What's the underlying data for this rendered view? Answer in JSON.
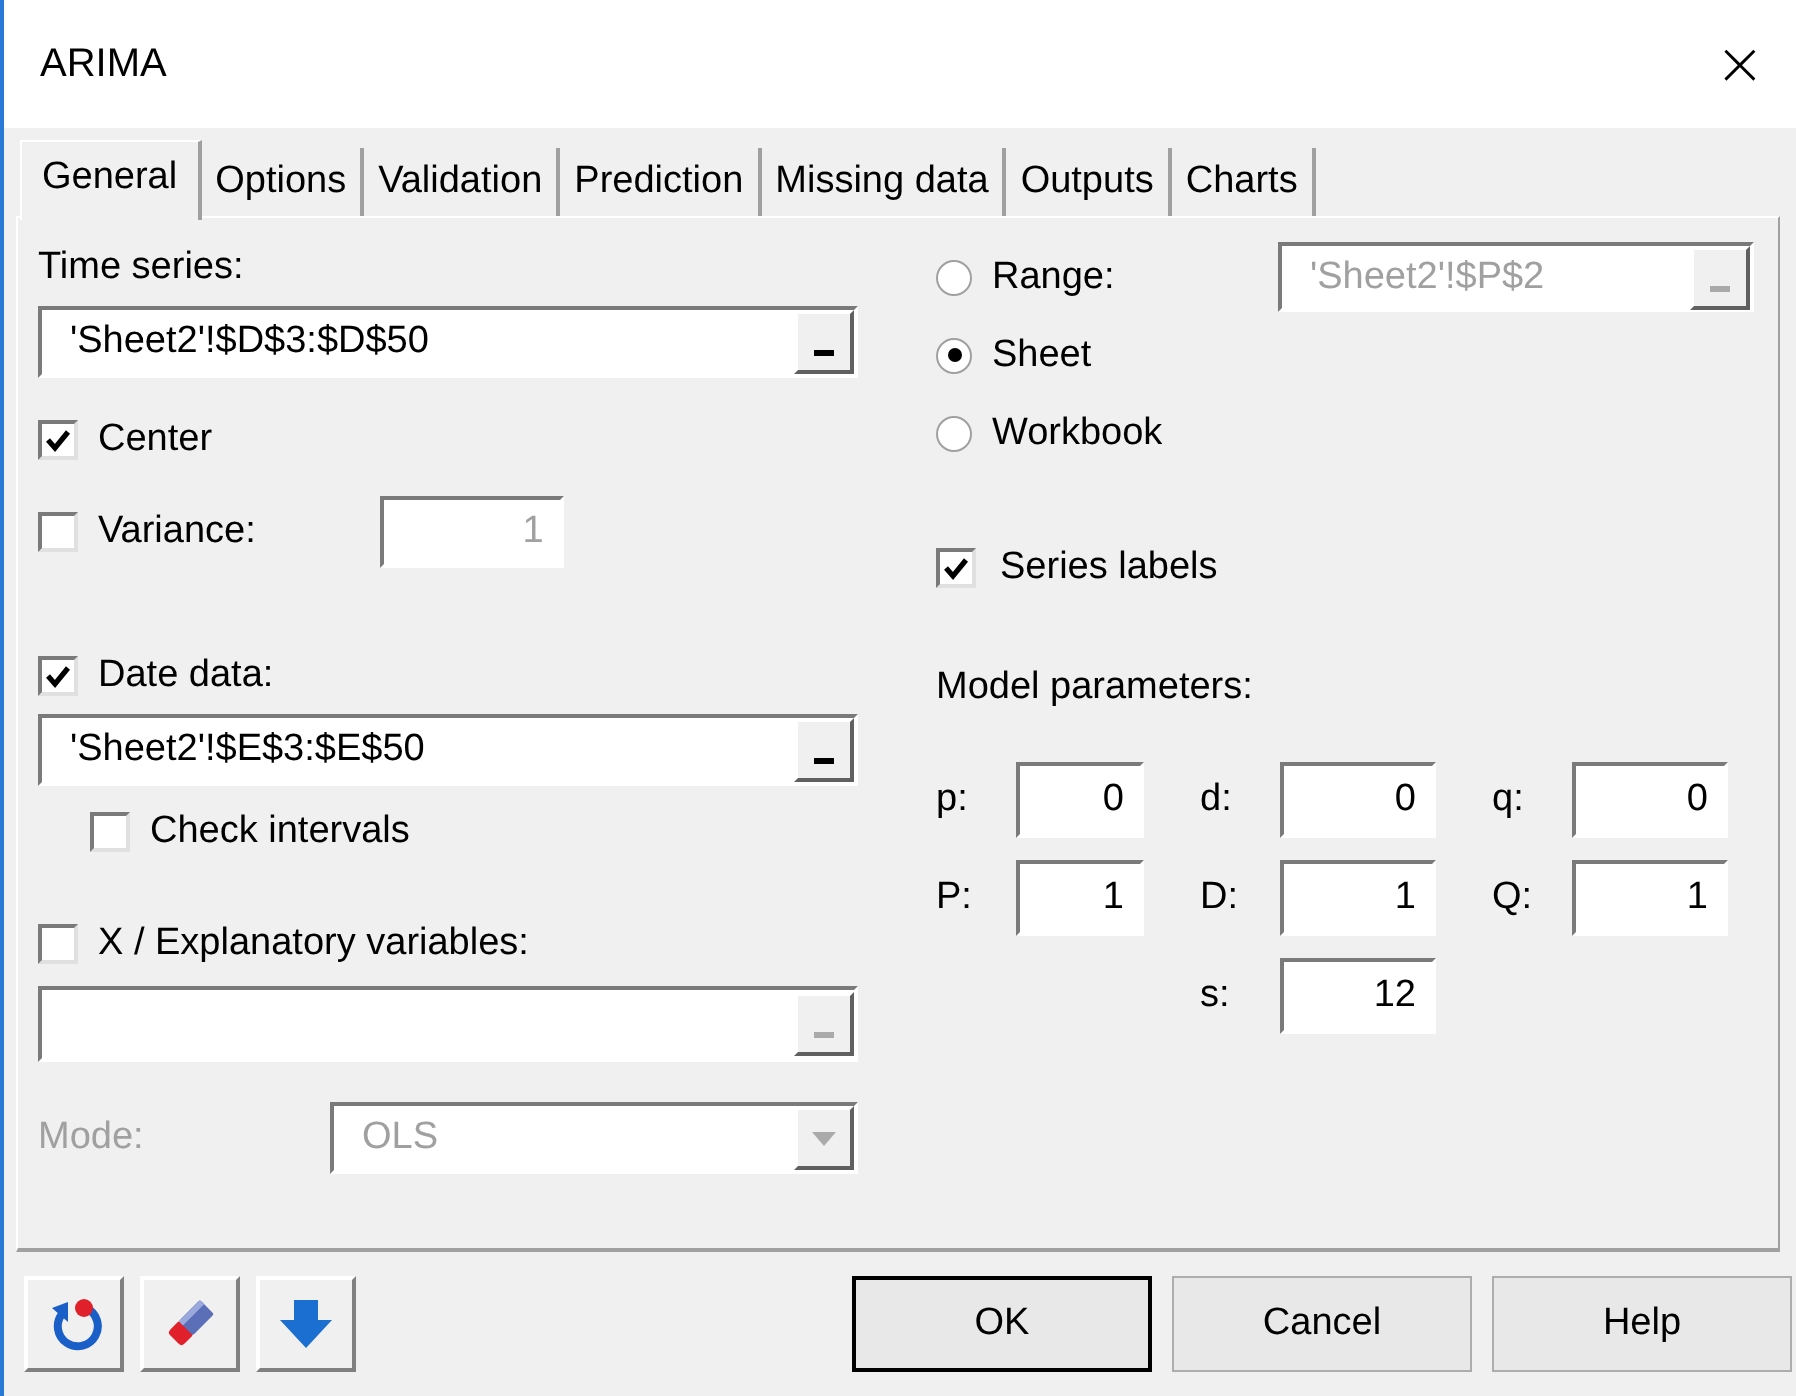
{
  "window": {
    "title": "ARIMA",
    "close": "×"
  },
  "tabs": [
    {
      "label": "General",
      "selected": true
    },
    {
      "label": "Options",
      "selected": false
    },
    {
      "label": "Validation",
      "selected": false
    },
    {
      "label": "Prediction",
      "selected": false
    },
    {
      "label": "Missing data",
      "selected": false
    },
    {
      "label": "Outputs",
      "selected": false
    },
    {
      "label": "Charts",
      "selected": false
    }
  ],
  "time_series": {
    "label": "Time series:",
    "value": "'Sheet2'!$D$3:$D$50",
    "disabled": false
  },
  "center": {
    "label": "Center",
    "checked": true
  },
  "variance": {
    "label": "Variance:",
    "checked": false,
    "value": "1",
    "disabled": true
  },
  "date_data": {
    "label": "Date data:",
    "checked": true,
    "value": "'Sheet2'!$E$3:$E$50",
    "disabled": false
  },
  "check_intervals": {
    "label": "Check intervals",
    "checked": false
  },
  "explanatory": {
    "label": "X / Explanatory variables:",
    "checked": false,
    "disabled": true
  },
  "mode": {
    "label": "Mode:",
    "value": "OLS",
    "disabled": true
  },
  "output_target": [
    {
      "label": "Range:",
      "selected": false
    },
    {
      "label": "Sheet",
      "selected": true
    },
    {
      "label": "Workbook",
      "selected": false
    }
  ],
  "range_field": {
    "value": "'Sheet2'!$P$2",
    "disabled": true
  },
  "series_labels": {
    "label": "Series labels",
    "checked": true
  },
  "model_parameters": {
    "title": "Model parameters:",
    "rows": [
      [
        {
          "label": "p:",
          "value": "0"
        },
        {
          "label": "d:",
          "value": "0"
        },
        {
          "label": "q:",
          "value": "0"
        }
      ],
      [
        {
          "label": "P:",
          "value": "1"
        },
        {
          "label": "D:",
          "value": "1"
        },
        {
          "label": "Q:",
          "value": "1"
        }
      ],
      [
        null,
        {
          "label": "s:",
          "value": "12"
        }
      ]
    ]
  },
  "tool_buttons": [
    {
      "kind": "reset"
    },
    {
      "kind": "clear"
    },
    {
      "kind": "down"
    }
  ],
  "buttons": [
    {
      "label": "OK",
      "default": true
    },
    {
      "label": "Cancel",
      "default": false
    },
    {
      "label": "Help",
      "default": false
    }
  ]
}
